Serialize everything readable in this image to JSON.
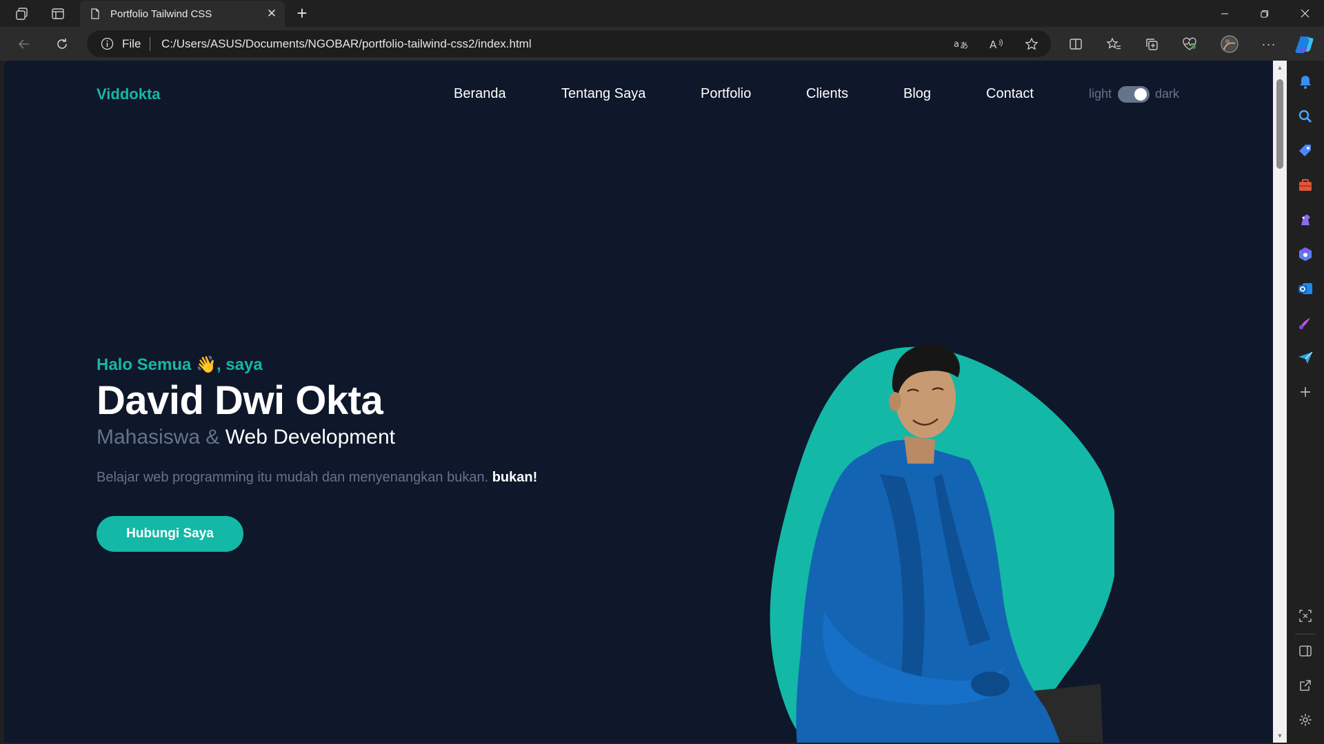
{
  "browser": {
    "tab_title": "Portfolio Tailwind CSS",
    "address_label": "File",
    "url": "C:/Users/ASUS/Documents/NGOBAR/portfolio-tailwind-css2/index.html"
  },
  "page": {
    "logo": "Viddokta",
    "nav": [
      "Beranda",
      "Tentang Saya",
      "Portfolio",
      "Clients",
      "Blog",
      "Contact"
    ],
    "theme_toggle": {
      "light_label": "light",
      "dark_label": "dark",
      "state": "dark"
    },
    "hero": {
      "greeting": "Halo Semua",
      "greeting_emoji": "👋",
      "greeting_suffix": ", saya",
      "name": "David Dwi Okta",
      "role_muted": "Mahasiswa &",
      "role_strong": "Web Development",
      "description": "Belajar web programming itu mudah dan menyenangkan bukan.",
      "description_bold": "bukan!",
      "cta_label": "Hubungi Saya"
    }
  },
  "colors": {
    "primary": "#14b8a6",
    "background": "#0f172a",
    "muted": "#64748b",
    "jacket": "#1464b4"
  }
}
